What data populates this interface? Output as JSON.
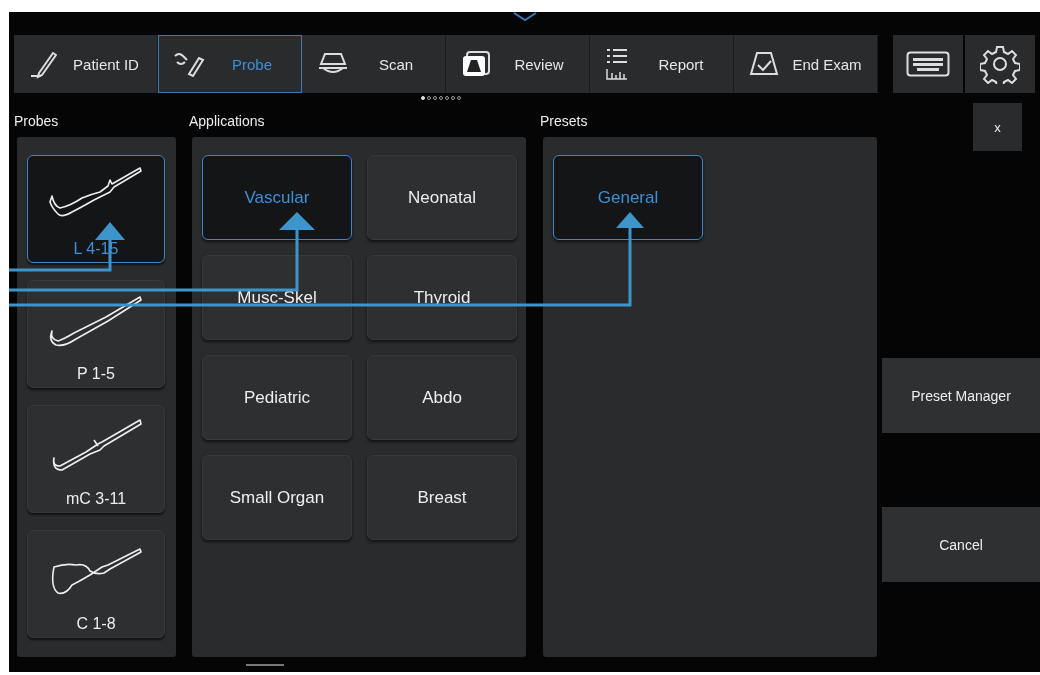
{
  "tabs": [
    {
      "label": "Patient ID",
      "selected": false
    },
    {
      "label": "Probe",
      "selected": true
    },
    {
      "label": "Scan",
      "selected": false
    },
    {
      "label": "Review",
      "selected": false
    },
    {
      "label": "Report",
      "selected": false
    },
    {
      "label": "End Exam",
      "selected": false
    }
  ],
  "pager": [
    {
      "selected": true
    },
    {
      "selected": false
    },
    {
      "selected": false
    },
    {
      "selected": false
    },
    {
      "selected": false
    },
    {
      "selected": false
    },
    {
      "selected": false
    }
  ],
  "sections": {
    "probes": "Probes",
    "applications": "Applications",
    "presets": "Presets"
  },
  "probes": [
    {
      "label": "L 4-15",
      "selected": true
    },
    {
      "label": "P 1-5",
      "selected": false
    },
    {
      "label": "mC 3-11",
      "selected": false
    },
    {
      "label": "C 1-8",
      "selected": false
    }
  ],
  "applications": [
    {
      "label": "Vascular",
      "selected": true
    },
    {
      "label": "Neonatal",
      "selected": false
    },
    {
      "label": "Musc-Skel",
      "selected": false
    },
    {
      "label": "Thyroid",
      "selected": false
    },
    {
      "label": "Pediatric",
      "selected": false
    },
    {
      "label": "Abdo",
      "selected": false
    },
    {
      "label": "Small Organ",
      "selected": false
    },
    {
      "label": "Breast",
      "selected": false
    }
  ],
  "presets": [
    {
      "label": "General",
      "selected": true
    }
  ],
  "close_button": "x",
  "preset_manager_button": "Preset Manager",
  "cancel_button": "Cancel"
}
